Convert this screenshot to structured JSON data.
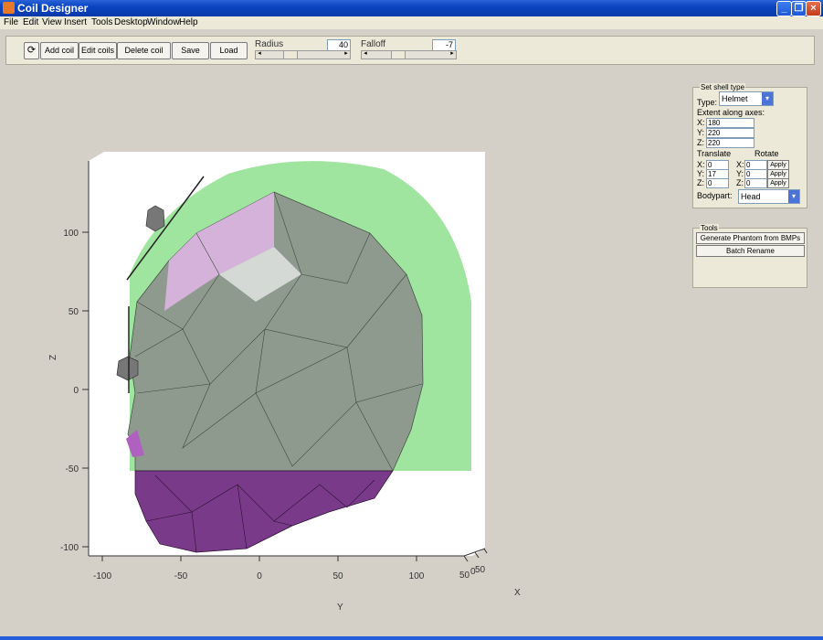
{
  "window": {
    "title": "Coil Designer"
  },
  "menu": [
    "File",
    "Edit",
    "View",
    "Insert",
    "Tools",
    "Desktop",
    "Window",
    "Help"
  ],
  "toolbar": {
    "add_coil": "Add coil",
    "edit_coils": "Edit coils",
    "delete_coil": "Delete coil",
    "save": "Save",
    "load": "Load",
    "radius_label": "Radius",
    "radius_value": "40",
    "falloff_label": "Falloff",
    "falloff_value": "-7"
  },
  "shell_panel": {
    "title": "Set shell type",
    "type_label": "Type:",
    "type_value": "Helmet",
    "extent_label": "Extent along axes:",
    "extent": {
      "x": "180",
      "y": "220",
      "z": "220"
    },
    "translate_label": "Translate",
    "rotate_label": "Rotate",
    "translate": {
      "x": "0",
      "y": "17",
      "z": "0"
    },
    "rotate": {
      "x": "0",
      "y": "0",
      "z": "0"
    },
    "apply": "Apply",
    "bodypart_label": "Bodypart:",
    "bodypart_value": "Head",
    "axis": {
      "x": "X:",
      "y": "Y:",
      "z": "Z:"
    }
  },
  "tools_panel": {
    "title": "Tools",
    "generate": "Generate Phantom from BMPs",
    "rename": "Batch Rename"
  },
  "plot": {
    "y_ticks": [
      "-100",
      "-50",
      "0",
      "50",
      "100"
    ],
    "z_ticks": [
      "-100",
      "-50",
      "0",
      "50",
      "100"
    ],
    "x_ticks": [
      "50",
      "0",
      "50"
    ],
    "y_label": "Y",
    "z_label": "Z",
    "x_label": "X"
  },
  "colors": {
    "titlebar": "#0a44c0",
    "helmet": "#90e890",
    "head": "#8c9a8c",
    "neck": "#7a3a8a"
  }
}
